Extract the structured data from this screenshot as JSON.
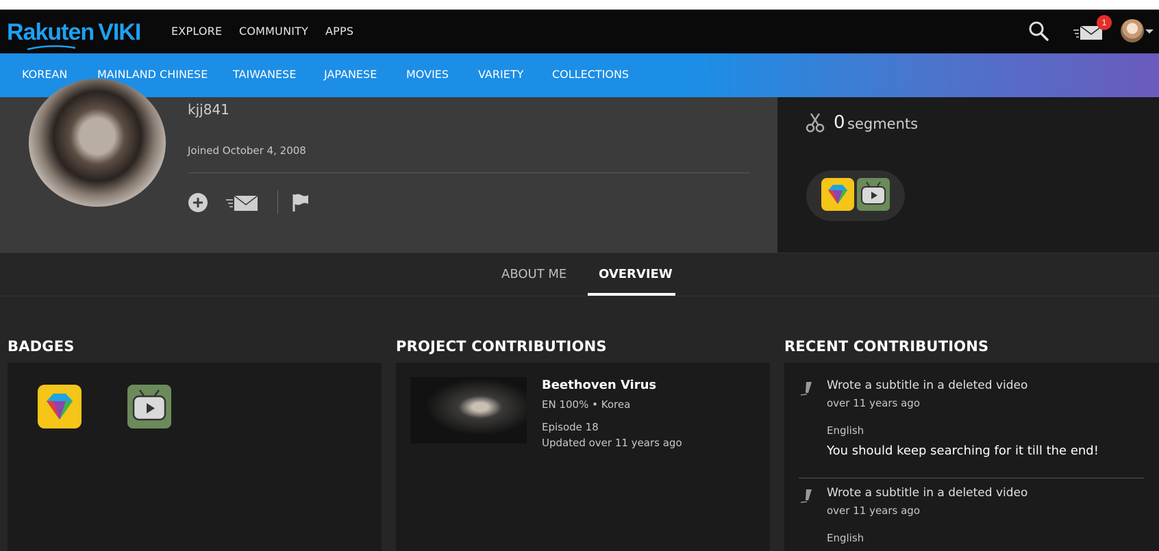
{
  "brand": {
    "name_part1": "Rakuten",
    "name_part2": "VIKI",
    "color": "#1da1f2"
  },
  "topnav": {
    "links": [
      "EXPLORE",
      "COMMUNITY",
      "APPS"
    ],
    "notification_count": "1"
  },
  "categories": [
    "KOREAN",
    "MAINLAND CHINESE",
    "TAIWANESE",
    "JAPANESE",
    "MOVIES",
    "VARIETY",
    "COLLECTIONS"
  ],
  "profile": {
    "username": "kjj841",
    "joined": "Joined October 4, 2008"
  },
  "stats": {
    "segments_count": "0",
    "segments_label": "segments"
  },
  "tabs": {
    "about": "ABOUT ME",
    "overview": "OVERVIEW",
    "active": "OVERVIEW"
  },
  "sections": {
    "badges": "BADGES",
    "projects": "PROJECT CONTRIBUTIONS",
    "recent": "RECENT CONTRIBUTIONS"
  },
  "project": {
    "title": "Beethoven Virus",
    "meta": "EN 100% • Korea",
    "episode": "Episode 18",
    "updated": "Updated over 11 years ago"
  },
  "recent": [
    {
      "action": "Wrote a subtitle in a deleted video",
      "time": "over 11 years ago",
      "language": "English",
      "text": "You should keep searching for it till the end!"
    },
    {
      "action": "Wrote a subtitle in a deleted video",
      "time": "over 11 years ago",
      "language": "English"
    }
  ],
  "colors": {
    "nav_bg": "#0a0a0a",
    "category_bar": "#1c8ee6",
    "profile_bg": "#3b3b3b",
    "panel_bg": "#1b1b1b",
    "badge_red": "#e52d27"
  },
  "icons": [
    "search-icon",
    "mail-icon",
    "follow-plus-icon",
    "message-icon",
    "flag-icon",
    "scissors-icon",
    "diamond-badge-icon",
    "tv-badge-icon",
    "pen-icon"
  ]
}
